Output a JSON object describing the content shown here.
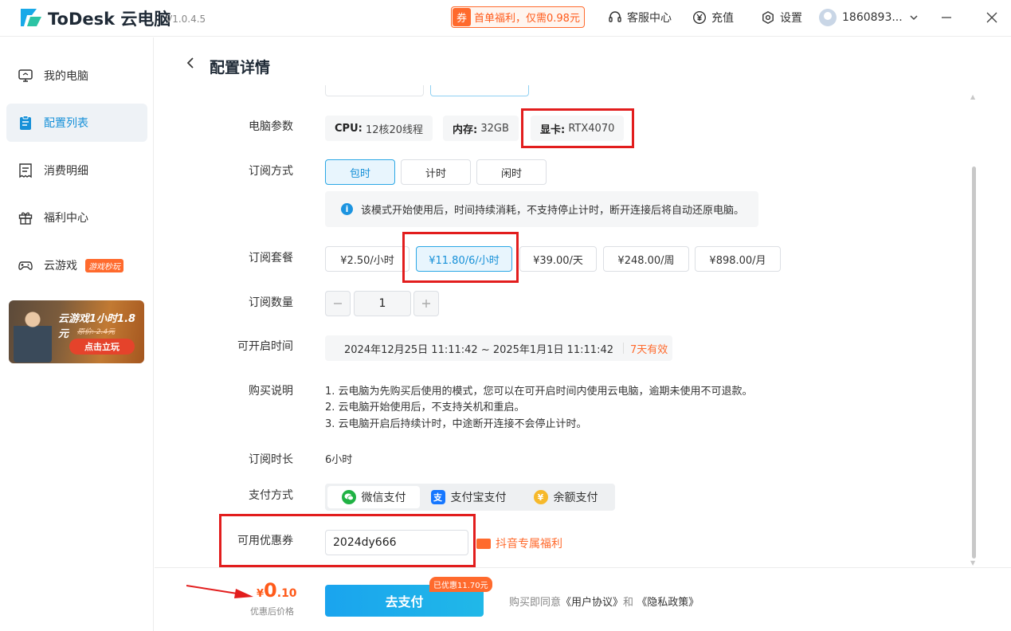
{
  "app": {
    "name": "ToDesk 云电脑",
    "version": "V1.0.4.5"
  },
  "titlebar": {
    "promo_tag": "券",
    "promo_text": "首单福利，仅需0.98元",
    "service": "客服中心",
    "recharge": "充值",
    "settings": "设置",
    "username": "1860893..."
  },
  "sidebar": {
    "items": [
      {
        "label": "我的电脑",
        "icon": "monitor-icon"
      },
      {
        "label": "配置列表",
        "icon": "clipboard-icon"
      },
      {
        "label": "消费明细",
        "icon": "receipt-icon"
      },
      {
        "label": "福利中心",
        "icon": "gift-icon"
      },
      {
        "label": "云游戏",
        "icon": "gamepad-icon",
        "badge": "游戏秒玩"
      }
    ],
    "banner": {
      "title": "云游戏1小时1.8元",
      "subtitle": "原价: 2.4元",
      "button": "点击立玩"
    }
  },
  "page": {
    "title": "配置详情",
    "specs_label": "电脑参数",
    "specs": [
      {
        "key": "CPU:",
        "value": "12核20线程"
      },
      {
        "key": "内存:",
        "value": "32GB"
      },
      {
        "key": "显卡:",
        "value": "RTX4070"
      }
    ],
    "mode_label": "订阅方式",
    "modes": [
      "包时",
      "计时",
      "闲时"
    ],
    "mode_selected": "包时",
    "mode_info": "该模式开始使用后，时间持续消耗，不支持停止计时，断开连接后将自动还原电脑。",
    "package_label": "订阅套餐",
    "packages": [
      "¥2.50/小时",
      "¥11.80/6/小时",
      "¥39.00/天",
      "¥248.00/周",
      "¥898.00/月"
    ],
    "package_selected": "¥11.80/6/小时",
    "quantity_label": "订阅数量",
    "quantity": "1",
    "time_label": "可开启时间",
    "time_range": "2024年12月25日 11:11:42 ~ 2025年1月1日 11:11:42",
    "time_valid": "7天有效",
    "notes_label": "购买说明",
    "notes": [
      "1. 云电脑为先购买后使用的模式，您可以在可开启时间内使用云电脑，逾期未使用不可退款。",
      "2. 云电脑开始使用后，不支持关机和重启。",
      "3. 云电脑开启后持续计时，中途断开连接不会停止计时。"
    ],
    "duration_label": "订阅时长",
    "duration": "6小时",
    "payment_label": "支付方式",
    "payments": [
      "微信支付",
      "支付宝支付",
      "余额支付"
    ],
    "payment_selected": "微信支付",
    "coupon_label": "可用优惠券",
    "coupon_value": "2024dy666",
    "coupon_link": "抖音专属福利"
  },
  "footer": {
    "price_yen": "¥",
    "price_int": "0",
    "price_dec": ".10",
    "price_label": "优惠后价格",
    "pay_button": "去支付",
    "discount_badge": "已优惠11.70元",
    "agree_prefix": "购买即同意",
    "agreement": "《用户协议》",
    "agree_and": "和",
    "privacy": "《隐私政策》"
  },
  "colors": {
    "accent": "#1690d8",
    "orange": "#ff6a2d",
    "highlight_red": "#e21d1d"
  }
}
